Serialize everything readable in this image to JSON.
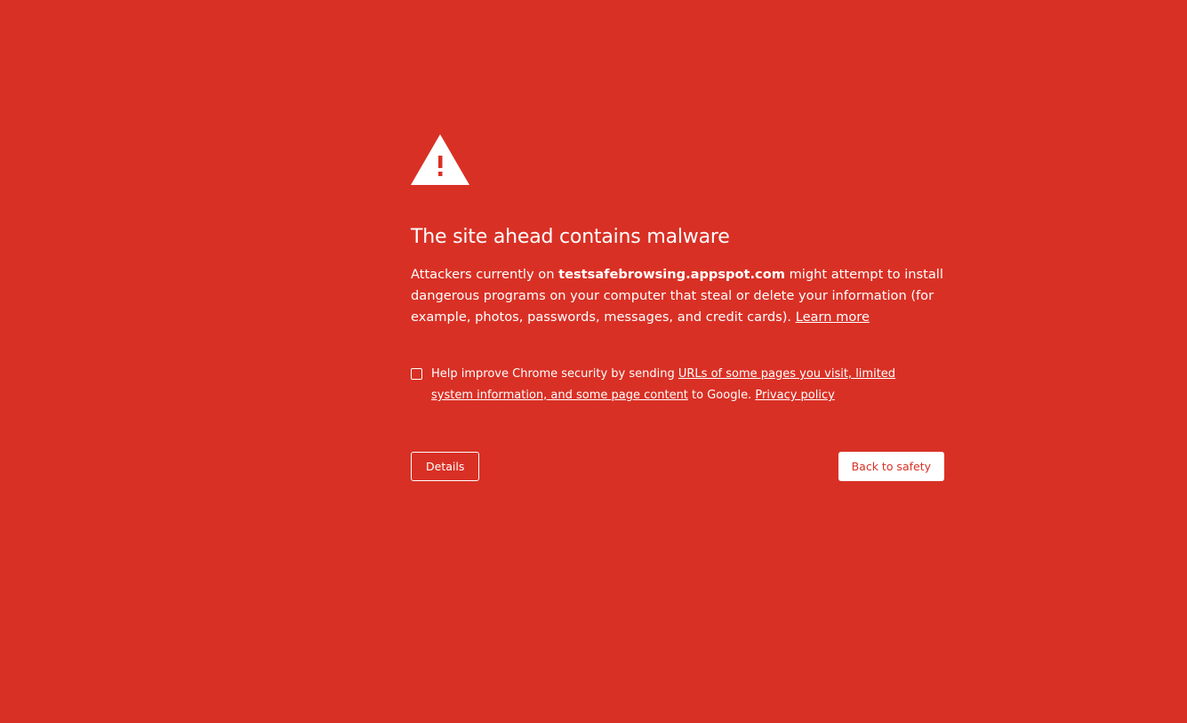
{
  "colors": {
    "background": "#d93025",
    "text": "#ffffff",
    "primary_button_text": "#d93025"
  },
  "icon": "warning-triangle-icon",
  "heading": "The site ahead contains malware",
  "main_message": {
    "prefix": "Attackers currently on ",
    "site": "testsafebrowsing.appspot.com",
    "suffix": " might attempt to install dangerous programs on your computer that steal or delete your information (for example, photos, passwords, messages, and credit cards). ",
    "learn_more": "Learn more"
  },
  "optin": {
    "checked": false,
    "prefix": "Help improve Chrome security by sending ",
    "link": "URLs of some pages you visit, limited system information, and some page content",
    "middle": " to Google. ",
    "privacy_link": "Privacy policy"
  },
  "buttons": {
    "details": "Details",
    "back_to_safety": "Back to safety"
  }
}
